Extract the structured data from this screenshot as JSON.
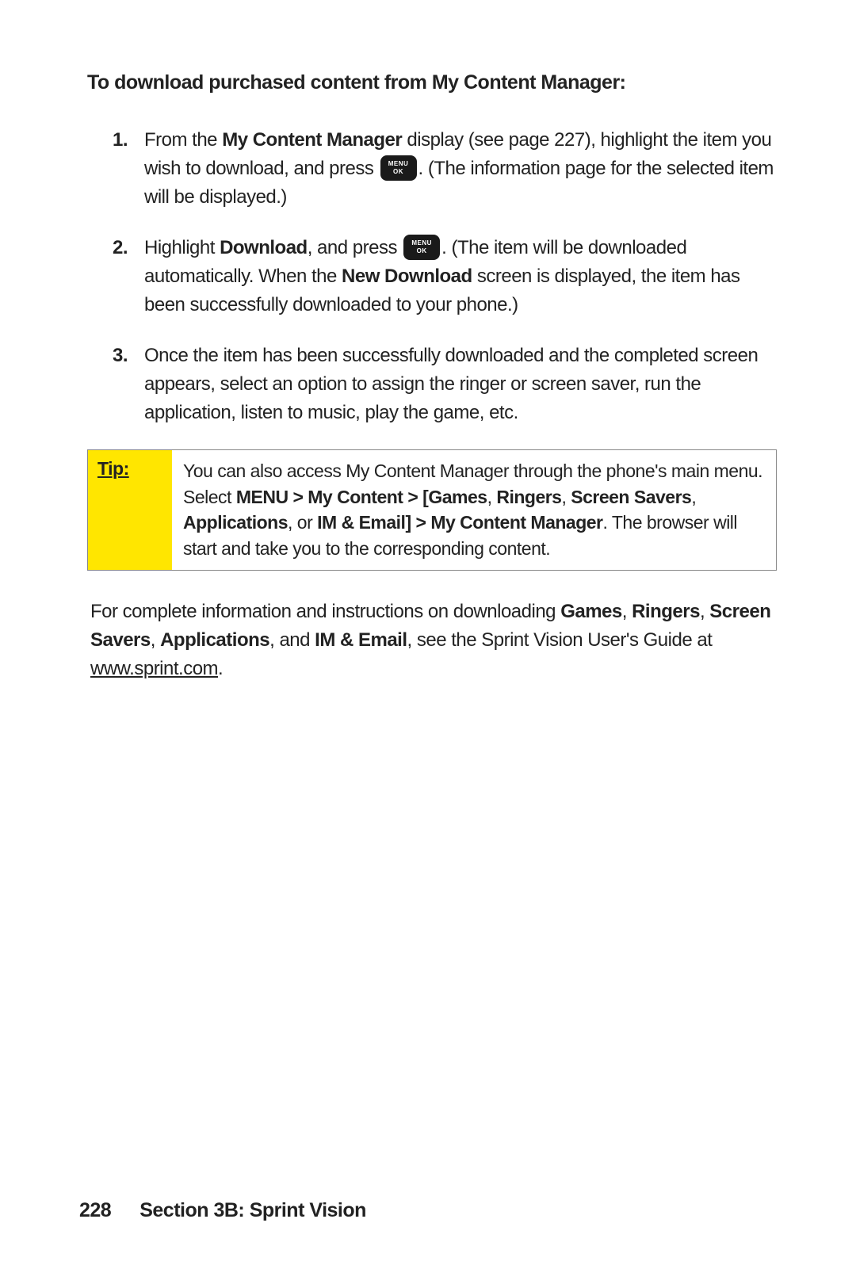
{
  "heading": "To download purchased content from My Content Manager:",
  "steps": {
    "s1a": "From the ",
    "s1b": "My Content Manager",
    "s1c": " display (see page 227), highlight the item you wish to download, and press ",
    "s1d": ". (The information page for the selected item will be displayed.)",
    "s2a": "Highlight ",
    "s2b": "Download",
    "s2c": ", and press ",
    "s2d": ". (The item will be downloaded automatically. When the ",
    "s2e": "New Download",
    "s2f": " screen is displayed, the item has been successfully downloaded to your phone.)",
    "s3": "Once the item has been successfully downloaded and the completed screen appears, select an option to assign the ringer or screen saver, run the application, listen to music, play the game, etc."
  },
  "tip": {
    "label": "Tip:",
    "t1": "You can also access My Content Manager through the phone's main menu. Select ",
    "t2": "MENU > My Content > [Games",
    "t3": ", ",
    "t4": "Ringers",
    "t5": ", ",
    "t6": "Screen Savers",
    "t7": ", ",
    "t8": "Applications",
    "t9": ", or ",
    "t10": "IM & Email] > My Content Manager",
    "t11": ". The browser will start and take you to the corresponding content."
  },
  "closing": {
    "c1": "For complete information and instructions on downloading ",
    "c2": "Games",
    "c3": ", ",
    "c4": "Ringers",
    "c5": ", ",
    "c6": "Screen Savers",
    "c7": ", ",
    "c8": "Applications",
    "c9": ", and ",
    "c10": "IM & Email",
    "c11": ", see the Sprint Vision User's Guide at  ",
    "c12": "www.sprint.com",
    "c13": "."
  },
  "footer": {
    "page": "228",
    "section": "Section 3B: Sprint Vision"
  }
}
